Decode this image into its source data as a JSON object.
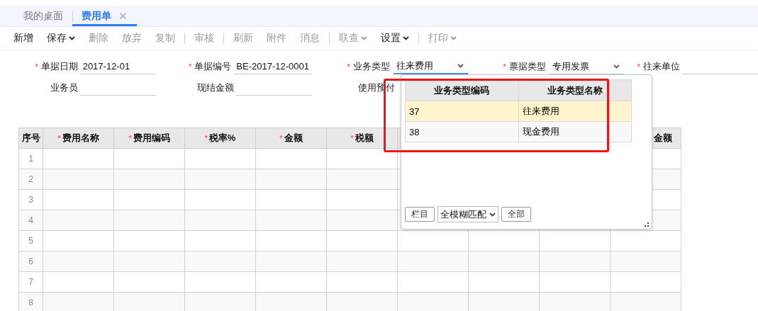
{
  "tabs": [
    {
      "label": "我的桌面",
      "selected": false,
      "closable": false
    },
    {
      "label": "费用单",
      "selected": true,
      "closable": true,
      "close_glyph": "✕"
    }
  ],
  "toolbar": [
    {
      "kind": "button",
      "label": "新增",
      "disabled": false,
      "has_menu": false
    },
    {
      "kind": "button",
      "label": "保存",
      "disabled": false,
      "has_menu": true
    },
    {
      "kind": "button",
      "label": "删除",
      "disabled": true,
      "has_menu": false
    },
    {
      "kind": "button",
      "label": "放弃",
      "disabled": true,
      "has_menu": false
    },
    {
      "kind": "button",
      "label": "复制",
      "disabled": true,
      "has_menu": false
    },
    {
      "kind": "separator"
    },
    {
      "kind": "button",
      "label": "审核",
      "disabled": true,
      "has_menu": false
    },
    {
      "kind": "separator"
    },
    {
      "kind": "button",
      "label": "刷新",
      "disabled": true,
      "has_menu": false
    },
    {
      "kind": "button",
      "label": "附件",
      "disabled": true,
      "has_menu": false
    },
    {
      "kind": "button",
      "label": "消息",
      "disabled": true,
      "has_menu": false
    },
    {
      "kind": "separator"
    },
    {
      "kind": "button",
      "label": "联查",
      "disabled": true,
      "has_menu": true
    },
    {
      "kind": "button",
      "label": "设置",
      "disabled": false,
      "has_menu": true
    },
    {
      "kind": "separator"
    },
    {
      "kind": "button",
      "label": "打印",
      "disabled": true,
      "has_menu": true
    }
  ],
  "form": {
    "rows": [
      [
        {
          "label": "单据日期",
          "required_mark": "*",
          "kind": "text",
          "value": "2017-12-01"
        },
        {
          "label": "单据编号",
          "required_mark": "*",
          "kind": "text",
          "value": "BE-2017-12-0001"
        },
        {
          "label": "业务类型",
          "required_mark": "*",
          "kind": "select",
          "value": "往来费用",
          "focused": true
        },
        {
          "label": "票据类型",
          "required_mark": "*",
          "kind": "select",
          "value": "专用发票",
          "focused": false
        },
        {
          "label": "往来单位",
          "required_mark": "*",
          "kind": "text"
        }
      ],
      [
        {
          "label": "业务员",
          "kind": "text"
        },
        {
          "label": "现结金额",
          "kind": "text"
        },
        {
          "label": "使用预付",
          "kind": "label"
        }
      ]
    ]
  },
  "table": {
    "columns": [
      {
        "label": "序号"
      },
      {
        "label": "费用名称",
        "required_mark": "*"
      },
      {
        "label": "费用编码",
        "required_mark": "*"
      },
      {
        "label": "税率%",
        "required_mark": "*"
      },
      {
        "label": "金额",
        "required_mark": "*"
      },
      {
        "label": "税额",
        "required_mark": "*"
      },
      {},
      {},
      {},
      {
        "label": "金额"
      }
    ],
    "rows": [
      {
        "number": "1"
      },
      {
        "number": "2"
      },
      {
        "number": "3"
      },
      {
        "number": "4"
      },
      {
        "number": "5"
      },
      {
        "number": "6"
      },
      {
        "number": "7"
      },
      {
        "number": "8"
      }
    ]
  },
  "dropdown": {
    "columns": [
      "业务类型编码",
      "业务类型名称"
    ],
    "options": [
      {
        "code": "37",
        "name": "往来费用",
        "selected": true
      },
      {
        "code": "38",
        "name": "现金费用",
        "selected": false
      }
    ],
    "columns_button": "栏目",
    "match_mode": "全模糊匹配",
    "all_button": "全部"
  }
}
